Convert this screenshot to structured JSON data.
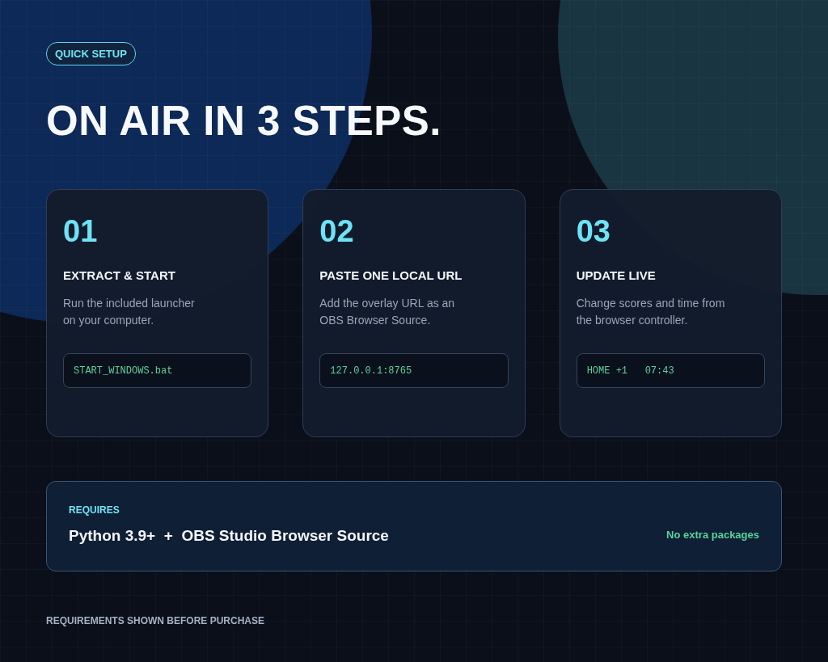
{
  "badge": "QUICK SETUP",
  "title": "ON AIR IN 3 STEPS.",
  "steps": [
    {
      "number": "01",
      "heading": "EXTRACT & START",
      "description": "Run the included launcher\non your computer.",
      "code": "START_WINDOWS.bat"
    },
    {
      "number": "02",
      "heading": "PASTE ONE LOCAL URL",
      "description": "Add the overlay URL as an\nOBS Browser Source.",
      "code": "127.0.0.1:8765"
    },
    {
      "number": "03",
      "heading": "UPDATE LIVE",
      "description": "Change scores and time from\nthe browser controller.",
      "code": "HOME +1   07:43"
    }
  ],
  "requirements": {
    "label": "REQUIRES",
    "items": "Python 3.9+  +  OBS Studio Browser Source",
    "note": "No extra packages"
  },
  "footer": "REQUIREMENTS SHOWN BEFORE PURCHASE"
}
